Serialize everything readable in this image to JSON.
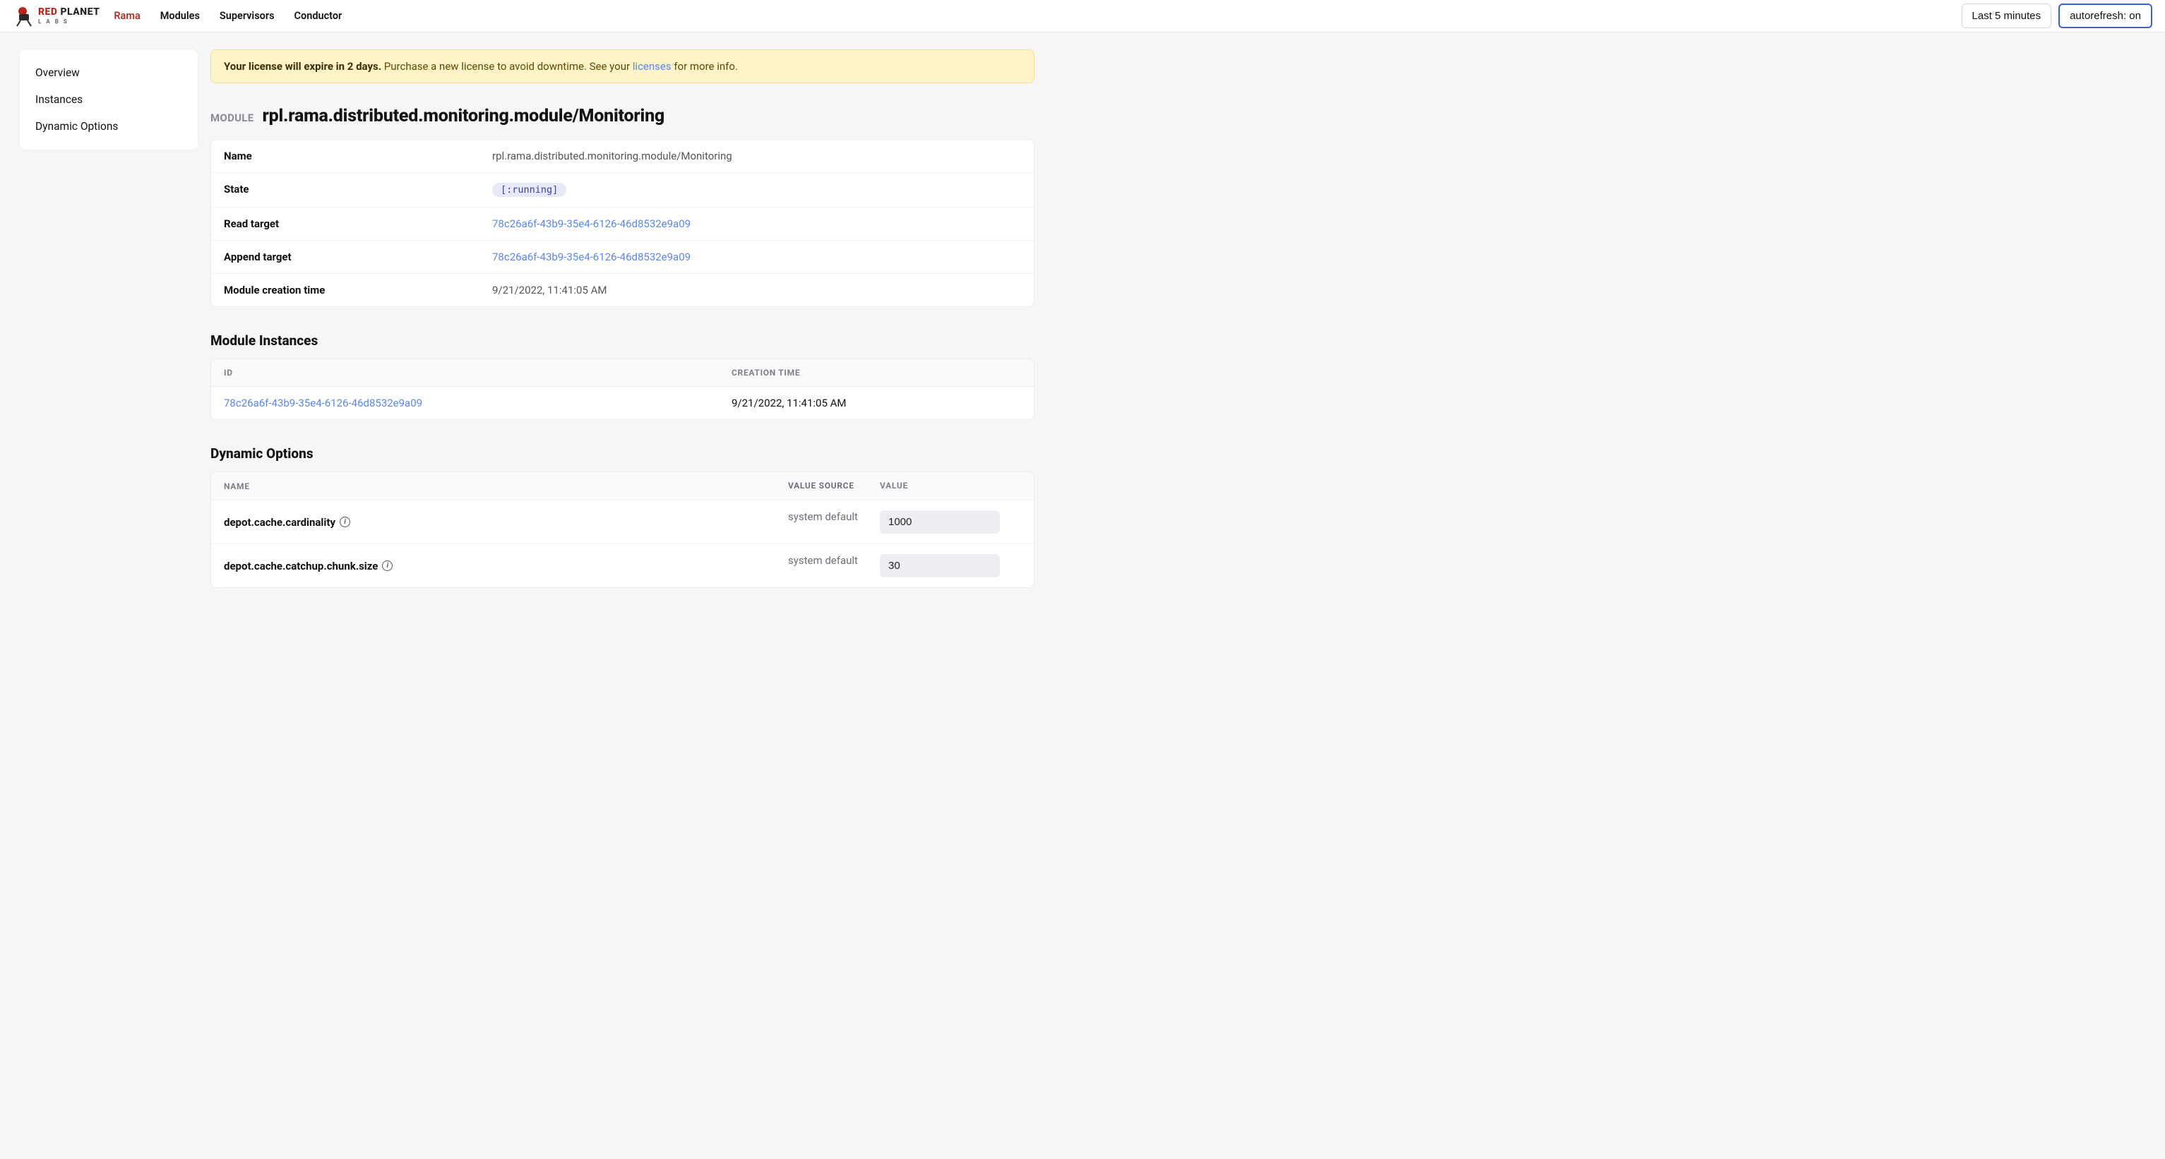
{
  "nav": {
    "logo_primary_a": "RED",
    "logo_primary_b": "PLANET",
    "logo_secondary": "LABS",
    "items": [
      "Rama",
      "Modules",
      "Supervisors",
      "Conductor"
    ],
    "timerange_label": "Last 5 minutes",
    "autorefresh_label": "autorefresh: on"
  },
  "sidebar": {
    "items": [
      "Overview",
      "Instances",
      "Dynamic Options"
    ]
  },
  "alert": {
    "bold": "Your license will expire in 2 days.",
    "text_a": " Purchase a new license to avoid downtime. See your ",
    "link": "licenses",
    "text_b": " for more info."
  },
  "module": {
    "eyebrow": "MODULE",
    "title": "rpl.rama.distributed.monitoring.module/Monitoring",
    "rows": {
      "name_label": "Name",
      "name_value": "rpl.rama.distributed.monitoring.module/Monitoring",
      "state_label": "State",
      "state_value": "[:running]",
      "read_target_label": "Read target",
      "read_target_value": "78c26a6f-43b9-35e4-6126-46d8532e9a09",
      "append_target_label": "Append target",
      "append_target_value": "78c26a6f-43b9-35e4-6126-46d8532e9a09",
      "created_label": "Module creation time",
      "created_value": "9/21/2022, 11:41:05 AM"
    }
  },
  "instances": {
    "heading": "Module Instances",
    "columns": {
      "id": "ID",
      "creation_time": "CREATION TIME"
    },
    "rows": [
      {
        "id": "78c26a6f-43b9-35e4-6126-46d8532e9a09",
        "creation_time": "9/21/2022, 11:41:05 AM"
      }
    ]
  },
  "dynamic_options": {
    "heading": "Dynamic Options",
    "columns": {
      "name": "NAME",
      "value_source": "VALUE SOURCE",
      "value": "VALUE"
    },
    "rows": [
      {
        "name": "depot.cache.cardinality",
        "source": "system default",
        "value": "1000"
      },
      {
        "name": "depot.cache.catchup.chunk.size",
        "source": "system default",
        "value": "30"
      }
    ]
  }
}
